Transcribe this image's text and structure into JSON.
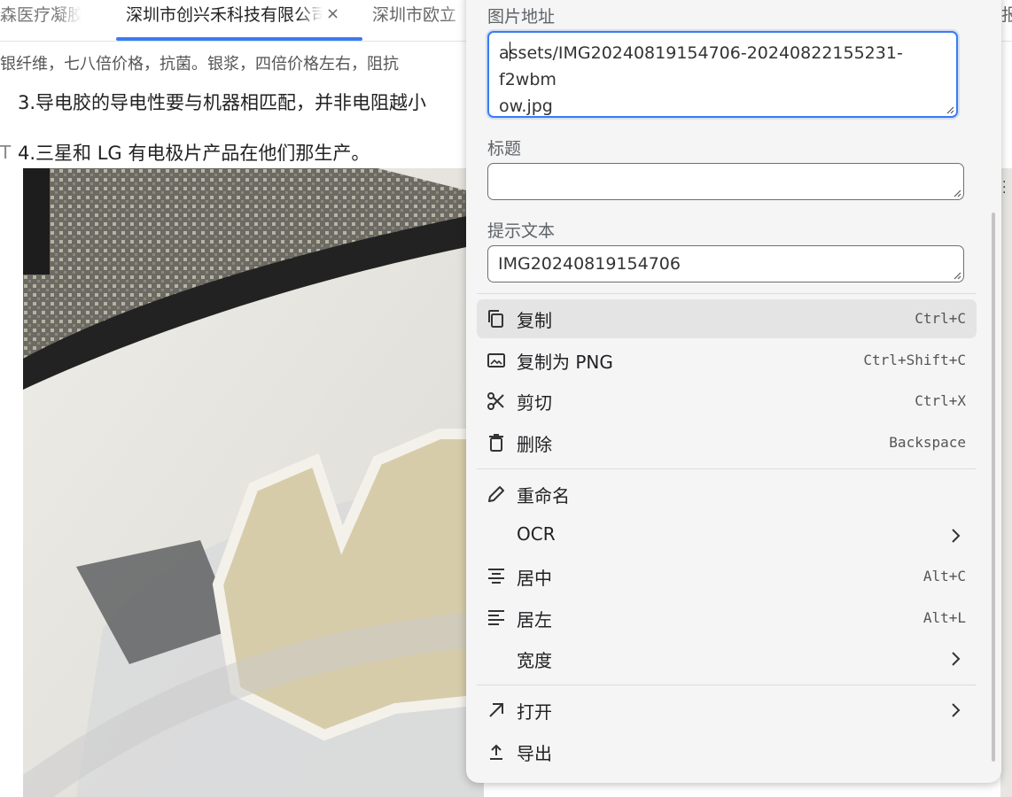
{
  "tabs": [
    {
      "label": "森医疗凝胶"
    },
    {
      "label": "深圳市创兴禾科技有限公司",
      "close": "×"
    },
    {
      "label": "深圳市欧立"
    },
    {
      "label": "报"
    }
  ],
  "document": {
    "line1": "银纤维，七八倍价格，抗菌。银浆，四倍价格左右，阻抗",
    "line2": "3.导电胶的导电性要与机器相匹配，并非电阻越小",
    "line3": "4.三星和 LG 有电极片产品在他们那生产。",
    "marker": "T"
  },
  "menu": {
    "image_url_label": "图片地址",
    "image_url_value_first": "a",
    "image_url_value_rest": "ssets/IMG20240819154706-20240822155231-f2wbm",
    "image_url_value_line2": "ow.jpg",
    "title_label": "标题",
    "title_value": "",
    "alt_label": "提示文本",
    "alt_value": "IMG20240819154706",
    "items": [
      {
        "label": "复制",
        "shortcut": "Ctrl+C",
        "icon": "copy-icon"
      },
      {
        "label": "复制为 PNG",
        "shortcut": "Ctrl+Shift+C",
        "icon": "image-icon"
      },
      {
        "label": "剪切",
        "shortcut": "Ctrl+X",
        "icon": "scissors-icon"
      },
      {
        "label": "删除",
        "shortcut": "Backspace",
        "icon": "trash-icon"
      },
      {
        "label": "重命名",
        "shortcut": "",
        "icon": "pencil-icon"
      },
      {
        "label": "OCR",
        "shortcut": "",
        "icon": ""
      },
      {
        "label": "居中",
        "shortcut": "Alt+C",
        "icon": "align-center-icon"
      },
      {
        "label": "居左",
        "shortcut": "Alt+L",
        "icon": "align-left-icon"
      },
      {
        "label": "宽度",
        "shortcut": "",
        "icon": ""
      },
      {
        "label": "打开",
        "shortcut": "",
        "icon": "open-external-icon"
      },
      {
        "label": "导出",
        "shortcut": "",
        "icon": "export-icon"
      }
    ]
  },
  "colors": {
    "accent": "#3a7cf0",
    "menu_bg": "#f5f5f5",
    "hover_bg": "#e4e4e4"
  }
}
